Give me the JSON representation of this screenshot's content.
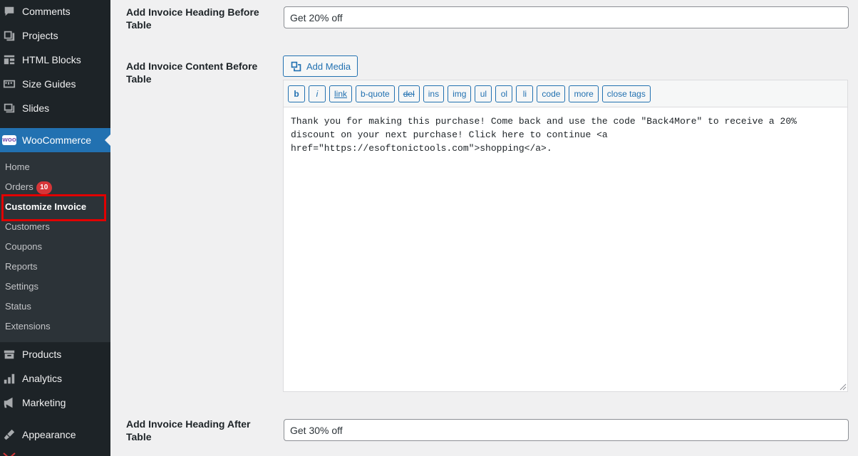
{
  "sidebar": {
    "top_items": [
      {
        "label": "Comments",
        "icon": "comments-icon"
      },
      {
        "label": "Projects",
        "icon": "projects-icon"
      },
      {
        "label": "HTML Blocks",
        "icon": "html-blocks-icon"
      },
      {
        "label": "Size Guides",
        "icon": "size-guides-icon"
      },
      {
        "label": "Slides",
        "icon": "slides-icon"
      }
    ],
    "woocommerce": {
      "label": "WooCommerce",
      "badge": "WOO"
    },
    "submenu": [
      {
        "label": "Home"
      },
      {
        "label": "Orders",
        "count": "10"
      },
      {
        "label": "Customize Invoice",
        "current": true
      },
      {
        "label": "Customers"
      },
      {
        "label": "Coupons"
      },
      {
        "label": "Reports"
      },
      {
        "label": "Settings"
      },
      {
        "label": "Status"
      },
      {
        "label": "Extensions"
      }
    ],
    "bottom_items": [
      {
        "label": "Products",
        "icon": "products-icon"
      },
      {
        "label": "Analytics",
        "icon": "analytics-icon"
      },
      {
        "label": "Marketing",
        "icon": "marketing-icon"
      },
      {
        "label": "Appearance",
        "icon": "appearance-icon"
      }
    ]
  },
  "main": {
    "heading_before": {
      "label": "Add Invoice Heading Before Table",
      "value": "Get 20% off"
    },
    "content_before": {
      "label": "Add Invoice Content Before Table",
      "add_media_label": "Add Media",
      "toolbar": [
        "b",
        "i",
        "link",
        "b-quote",
        "del",
        "ins",
        "img",
        "ul",
        "ol",
        "li",
        "code",
        "more",
        "close tags"
      ],
      "content": "Thank you for making this purchase! Come back and use the code \"Back4More\" to receive a 20% discount on your next purchase! Click here to continue <a href=\"https://esoftonictools.com\">shopping</a>."
    },
    "heading_after": {
      "label": "Add Invoice Heading After Table",
      "value": "Get 30% off"
    }
  },
  "colors": {
    "sidebar_bg": "#1d2327",
    "submenu_bg": "#2c3338",
    "accent": "#2271b1",
    "highlight": "#e10000",
    "badge": "#d63638"
  }
}
